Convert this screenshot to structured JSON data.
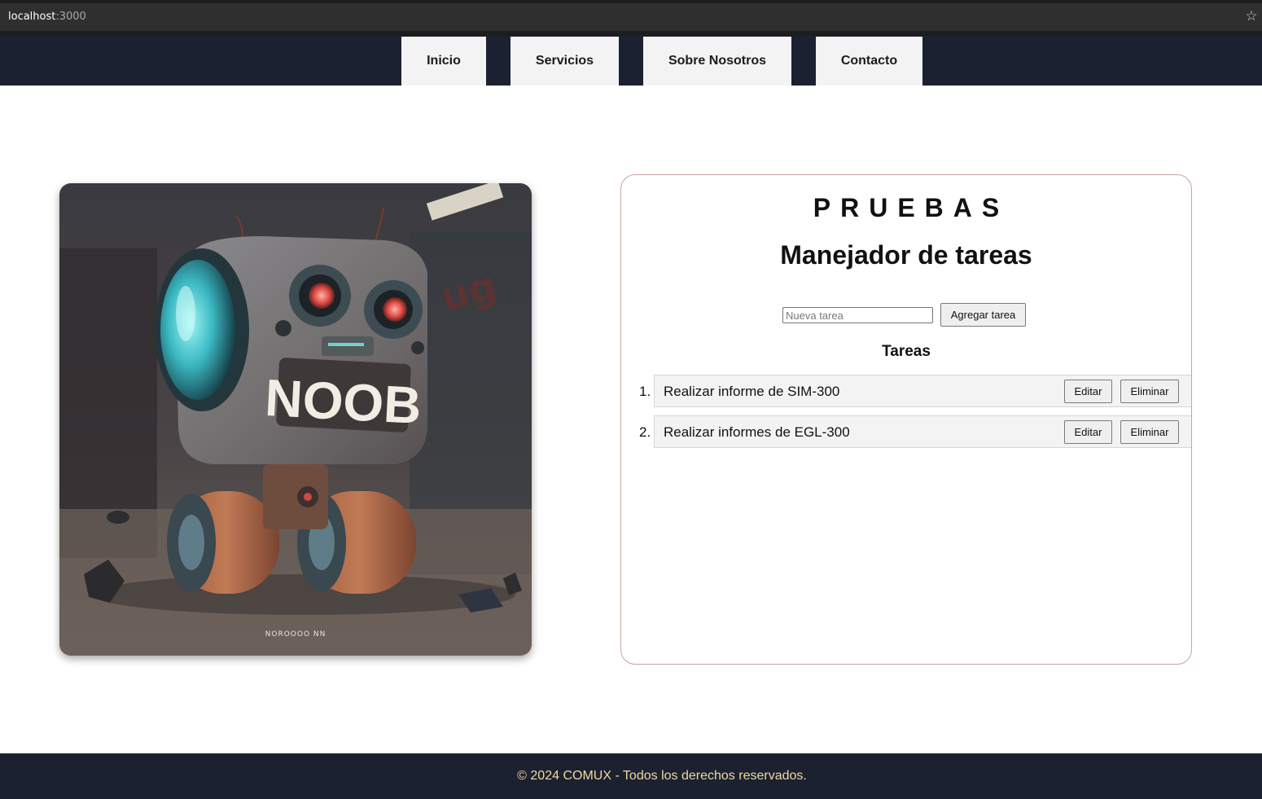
{
  "browser": {
    "host": "localhost",
    "port": ":3000",
    "bookmark_icon": "star-icon"
  },
  "nav": {
    "items": [
      {
        "label": "Inicio"
      },
      {
        "label": "Servicios"
      },
      {
        "label": "Sobre Nosotros"
      },
      {
        "label": "Contacto"
      }
    ]
  },
  "hero_image": {
    "sign_text": "NOOB",
    "watermark": "NOROOOO NN"
  },
  "panel": {
    "brand": "PRUEBAS",
    "title": "Manejador de tareas",
    "new_task_placeholder": "Nueva tarea",
    "new_task_value": "",
    "add_button": "Agregar tarea",
    "list_title": "Tareas",
    "tasks": [
      {
        "number": "1.",
        "text": "Realizar informe de SIM-300",
        "edit": "Editar",
        "delete": "Eliminar"
      },
      {
        "number": "2.",
        "text": "Realizar informes de EGL-300",
        "edit": "Editar",
        "delete": "Eliminar"
      }
    ]
  },
  "footer": {
    "text": "© 2024 COMUX - Todos los derechos reservados."
  },
  "colors": {
    "nav_bg": "#1b2130",
    "nav_item_bg": "#f3f3f3",
    "footer_text": "#f1d9a0",
    "panel_border": "#c9a3a0"
  }
}
